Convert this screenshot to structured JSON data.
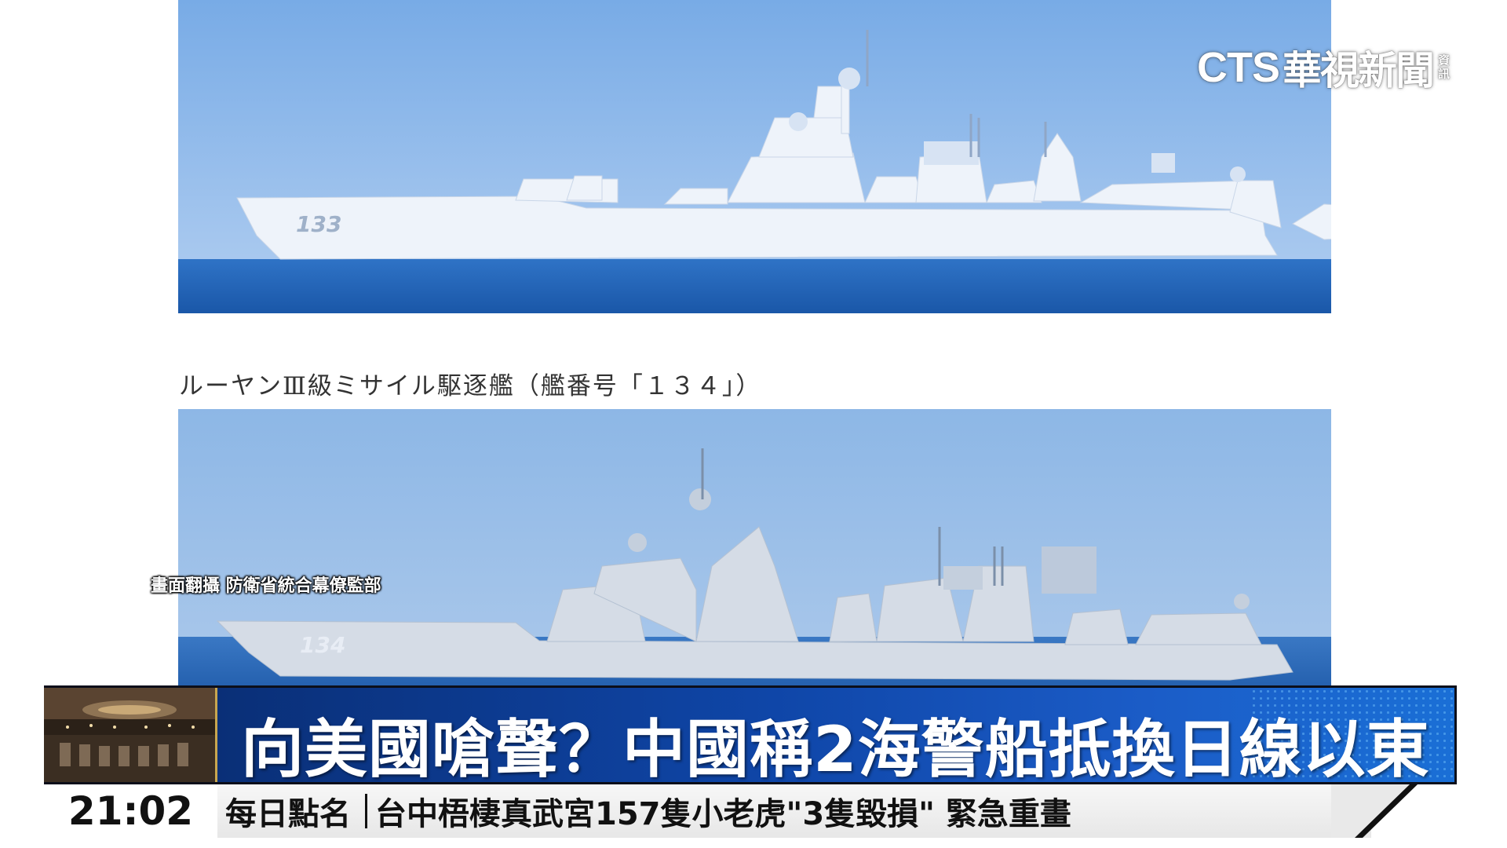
{
  "broadcaster": {
    "logo_latin": "CTS",
    "logo_cn": "華視新聞",
    "logo_small_1": "資",
    "logo_small_2": "訊"
  },
  "document": {
    "caption": "ルーヤンⅢ級ミサイル駆逐艦（艦番号「１３４」）",
    "hull_number_top": "133",
    "hull_number_bottom": "134"
  },
  "credit": "畫面翻攝 防衛省統合幕僚監部",
  "headline": "向美國嗆聲？中國稱2海警船抵換日線以東",
  "ticker": {
    "time": "21:02",
    "tag": "每日點名",
    "text": "台中梧棲真武宮157隻小老虎\"3隻毀損\" 緊急重畫"
  },
  "colors": {
    "headline_bg": "#0f46a8",
    "ticker_bg": "#ececec",
    "sky_top": "#7fb0e6",
    "sea": "#1d5fb5"
  }
}
